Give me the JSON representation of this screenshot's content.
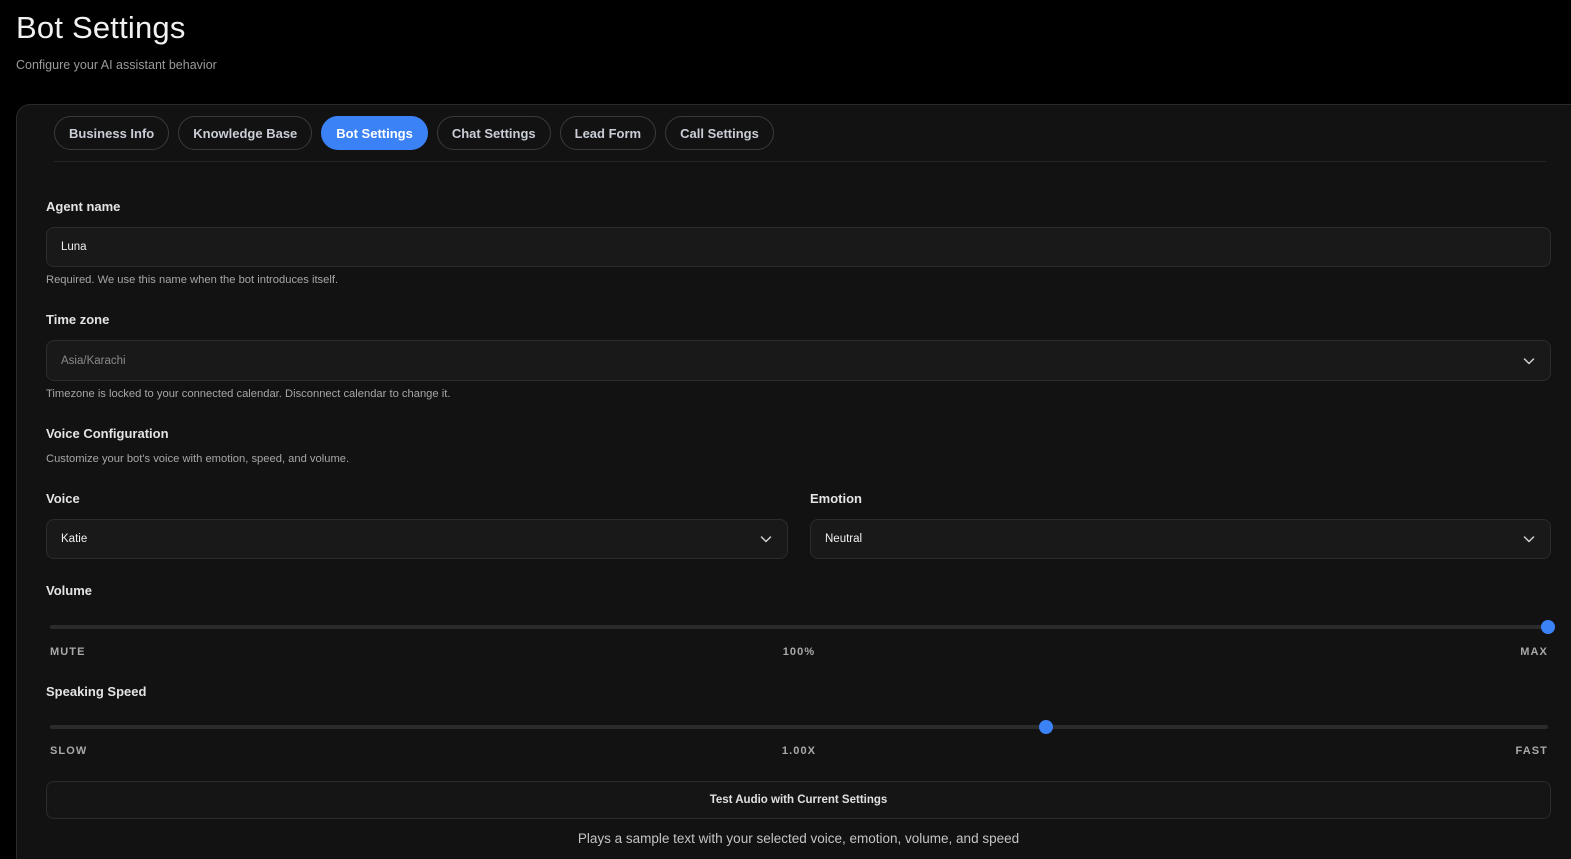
{
  "header": {
    "title": "Bot Settings",
    "subtitle": "Configure your AI assistant behavior"
  },
  "tabs": [
    {
      "label": "Business Info",
      "active": false
    },
    {
      "label": "Knowledge Base",
      "active": false
    },
    {
      "label": "Bot Settings",
      "active": true
    },
    {
      "label": "Chat Settings",
      "active": false
    },
    {
      "label": "Lead Form",
      "active": false
    },
    {
      "label": "Call Settings",
      "active": false
    }
  ],
  "agent_name": {
    "label": "Agent name",
    "value": "Luna",
    "hint": "Required. We use this name when the bot introduces itself."
  },
  "time_zone": {
    "label": "Time zone",
    "value": "Asia/Karachi",
    "hint": "Timezone is locked to your connected calendar. Disconnect calendar to change it."
  },
  "voice_config": {
    "heading": "Voice Configuration",
    "description": "Customize your bot's voice with emotion, speed, and volume.",
    "voice": {
      "label": "Voice",
      "value": "Katie"
    },
    "emotion": {
      "label": "Emotion",
      "value": "Neutral"
    },
    "volume": {
      "label": "Volume",
      "min_label": "MUTE",
      "value_label": "100%",
      "max_label": "MAX",
      "level": 1.0
    },
    "speed": {
      "label": "Speaking Speed",
      "min_label": "SLOW",
      "value_label": "1.00X",
      "max_label": "FAST",
      "level": 0.665
    }
  },
  "test_audio": {
    "button_label": "Test Audio with Current Settings",
    "note": "Plays a sample text with your selected voice, emotion, volume, and speed"
  },
  "icons": {
    "dropdown": "chevron-down-icon"
  },
  "colors": {
    "accent": "#3b82f6",
    "background": "#000000",
    "panel": "#121212"
  }
}
